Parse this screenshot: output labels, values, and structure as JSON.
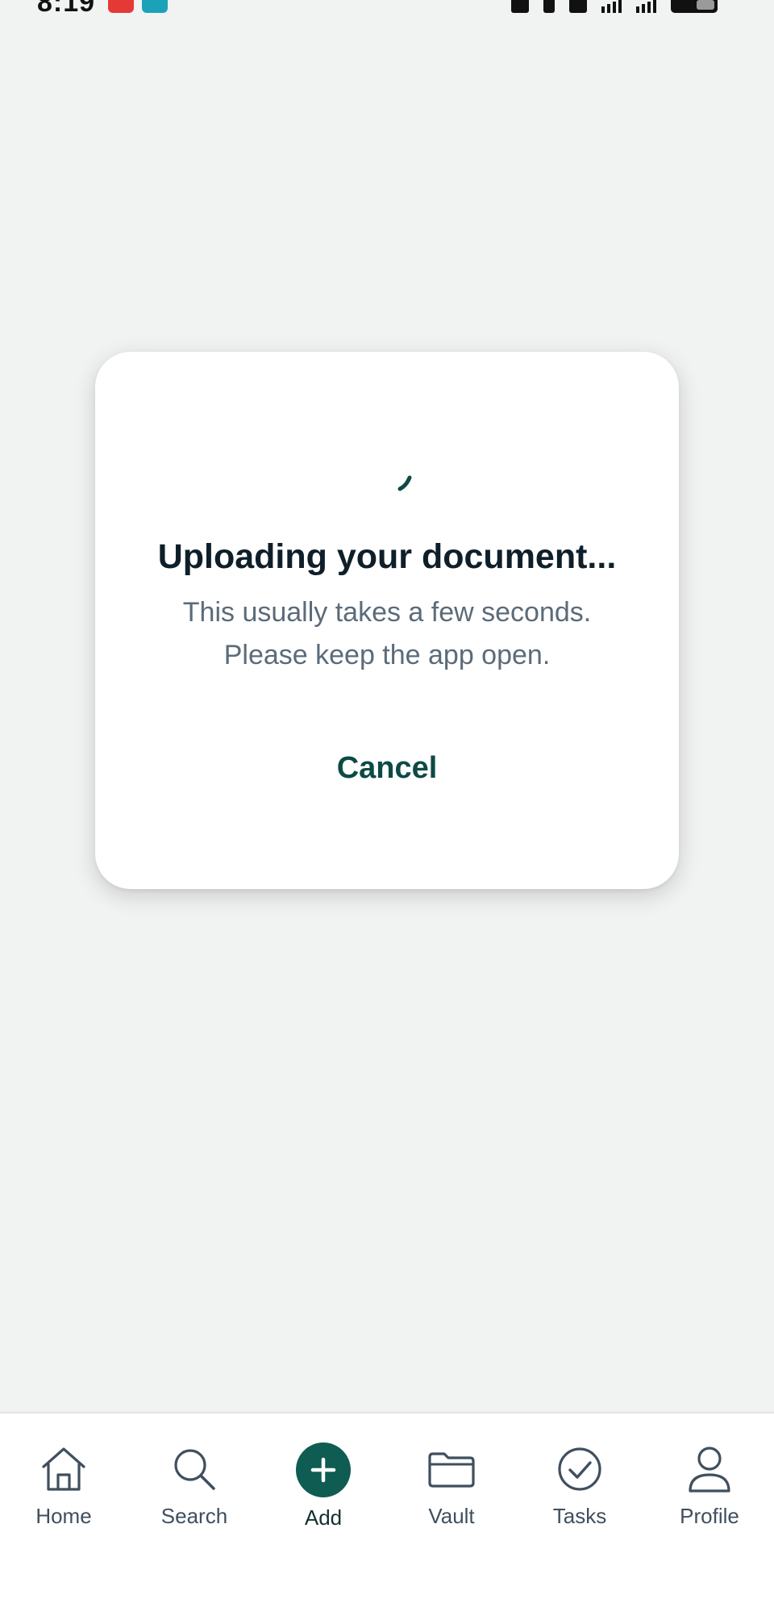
{
  "status_bar": {
    "time": "8:19"
  },
  "dialog": {
    "title": "Uploading your document...",
    "message_line1": "This usually takes a few seconds.",
    "message_line2": "Please keep the app open.",
    "cancel_label": "Cancel"
  },
  "bottom_nav": {
    "items": [
      {
        "label": "Home",
        "icon": "home-icon"
      },
      {
        "label": "Search",
        "icon": "search-icon"
      },
      {
        "label": "Add",
        "icon": "plus-icon"
      },
      {
        "label": "Vault",
        "icon": "folder-icon"
      },
      {
        "label": "Tasks",
        "icon": "check-circle-icon"
      },
      {
        "label": "Profile",
        "icon": "person-icon"
      }
    ]
  },
  "colors": {
    "background": "#f1f2f2",
    "accent": "#0f5c52",
    "title_text": "#0f1f2a",
    "secondary_text": "#5b6b7a",
    "nav_text": "#3f4f5e"
  }
}
